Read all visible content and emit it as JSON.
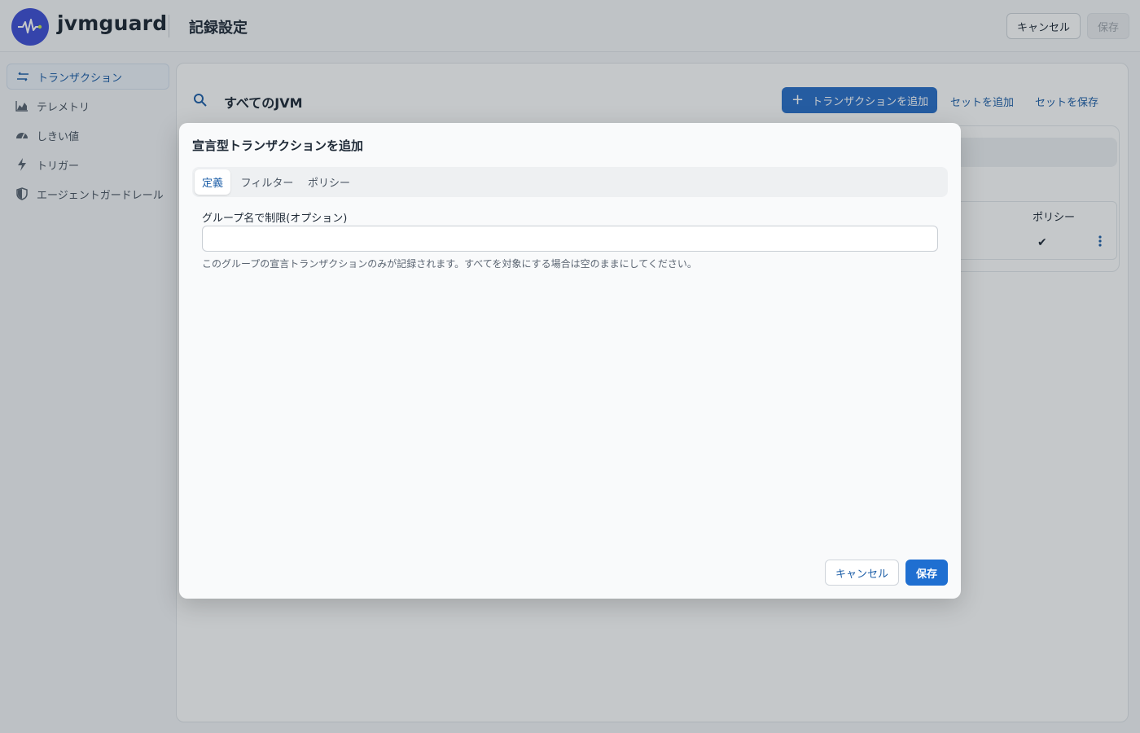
{
  "header": {
    "brand": "jvmguard",
    "title": "記録設定",
    "cancel_label": "キャンセル",
    "save_label": "保存"
  },
  "sidebar": {
    "items": [
      {
        "label": "トランザクション",
        "icon": "arrows-icon",
        "active": true
      },
      {
        "label": "テレメトリ",
        "icon": "area-chart-icon",
        "active": false
      },
      {
        "label": "しきい値",
        "icon": "gauge-icon",
        "active": false
      },
      {
        "label": "トリガー",
        "icon": "lightning-icon",
        "active": false
      },
      {
        "label": "エージェントガードレール",
        "icon": "shield-icon",
        "active": false
      }
    ]
  },
  "main": {
    "scope_label": "すべてのJVM",
    "add_transaction_label": "トランザクションを追加",
    "add_set_label": "セットを追加",
    "save_set_label": "セットを保存",
    "table": {
      "policy_header": "ポリシー",
      "row_check": "✔"
    }
  },
  "modal": {
    "title": "宣言型トランザクションを追加",
    "tabs": [
      "定義",
      "フィルター",
      "ポリシー"
    ],
    "active_tab": 0,
    "field": {
      "label": "グループ名で制限(オプション)",
      "value": "",
      "placeholder": "",
      "help": "このグループの宣言トランザクションのみが記録されます。すべてを対象にする場合は空のままにしてください。"
    },
    "cancel_label": "キャンセル",
    "save_label": "保存"
  },
  "colors": {
    "accent": "#2a6fc9",
    "logo": "#3f4fd6"
  }
}
